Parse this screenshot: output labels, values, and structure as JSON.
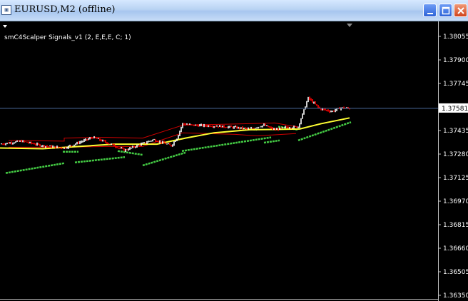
{
  "window": {
    "title": "EURUSD,M2 (offline)"
  },
  "indicator": {
    "label": "smC4Scalper Signals_v1 (2, E,E,E, C; 1)"
  },
  "price_axis": {
    "ticks": [
      "1.38055",
      "1.37900",
      "1.37745",
      "1.37590",
      "1.37435",
      "1.37280",
      "1.37125",
      "1.36970",
      "1.36815",
      "1.36660",
      "1.36505",
      "1.36350"
    ],
    "current_price": "1.37581"
  },
  "colors": {
    "background": "#000000",
    "bull_candle": "#ffffff",
    "bear_candle": "#ff0000",
    "envelope_line": "#cc0000",
    "ma_yellow": "#ffff33",
    "signal_green": "#44cc44",
    "current_price_line": "#4a6a9a"
  },
  "icons": {
    "app": "chart-window-icon",
    "minimize": "minimize-icon",
    "maximize": "maximize-icon",
    "close": "close-icon",
    "chart_shift": "chart-shift-triangle-icon"
  }
}
